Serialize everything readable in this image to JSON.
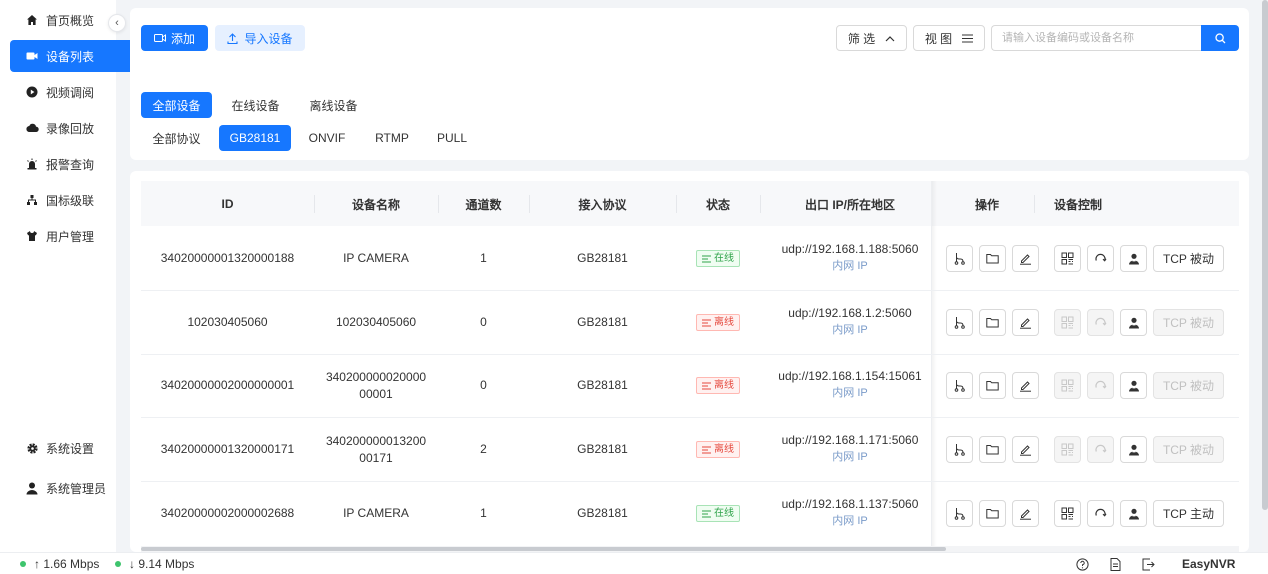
{
  "sidebar": {
    "items": [
      {
        "label": "首页概览",
        "icon": "home-icon"
      },
      {
        "label": "设备列表",
        "icon": "camera-icon"
      },
      {
        "label": "视频调阅",
        "icon": "play-icon"
      },
      {
        "label": "录像回放",
        "icon": "cloud-icon"
      },
      {
        "label": "报警查询",
        "icon": "alarm-icon"
      },
      {
        "label": "国标级联",
        "icon": "cascade-icon"
      },
      {
        "label": "用户管理",
        "icon": "shirt-icon"
      }
    ],
    "bottom": [
      {
        "label": "系统设置",
        "icon": "gear-icon"
      },
      {
        "label": "系统管理员",
        "icon": "user-icon"
      }
    ],
    "active_index": 1
  },
  "toolbar": {
    "add_label": "添加",
    "import_label": "导入设备",
    "filter_label": "筛 选",
    "view_label": "视 图",
    "search_placeholder": "请输入设备编码或设备名称"
  },
  "status_tabs": [
    "全部设备",
    "在线设备",
    "离线设备"
  ],
  "protocol_tabs": [
    "全部协议",
    "GB28181",
    "ONVIF",
    "RTMP",
    "PULL"
  ],
  "table": {
    "headers": {
      "id": "ID",
      "name": "设备名称",
      "channels": "通道数",
      "protocol": "接入协议",
      "status": "状态",
      "ip": "出口 IP/所在地区",
      "ops": "操作",
      "control": "设备控制"
    },
    "rows": [
      {
        "id": "34020000001320000188",
        "name": "IP CAMERA",
        "channels": "1",
        "protocol": "GB28181",
        "status": "在线",
        "online": true,
        "ip": "udp://192.168.1.188:5060",
        "region": "内网 IP",
        "tcp": "TCP 被动"
      },
      {
        "id": "102030405060",
        "name": "102030405060",
        "channels": "0",
        "protocol": "GB28181",
        "status": "离线",
        "online": false,
        "ip": "udp://192.168.1.2:5060",
        "region": "内网 IP",
        "tcp": "TCP 被动"
      },
      {
        "id": "34020000002000000001",
        "name": "340200000020000\n00001",
        "channels": "0",
        "protocol": "GB28181",
        "status": "离线",
        "online": false,
        "ip": "udp://192.168.1.154:15061",
        "region": "内网 IP",
        "tcp": "TCP 被动"
      },
      {
        "id": "34020000001320000171",
        "name": "340200000013200\n00171",
        "channels": "2",
        "protocol": "GB28181",
        "status": "离线",
        "online": false,
        "ip": "udp://192.168.1.171:5060",
        "region": "内网 IP",
        "tcp": "TCP 被动"
      },
      {
        "id": "34020000002000002688",
        "name": "IP CAMERA",
        "channels": "1",
        "protocol": "GB28181",
        "status": "在线",
        "online": true,
        "ip": "udp://192.168.1.137:5060",
        "region": "内网 IP",
        "tcp": "TCP 主动"
      }
    ]
  },
  "footer": {
    "upload": "↑ 1.66 Mbps",
    "download": "↓ 9.14 Mbps",
    "brand": "EasyNVR"
  },
  "colors": {
    "primary": "#1677ff",
    "online": "#2fa34a",
    "offline": "#e5483d"
  }
}
